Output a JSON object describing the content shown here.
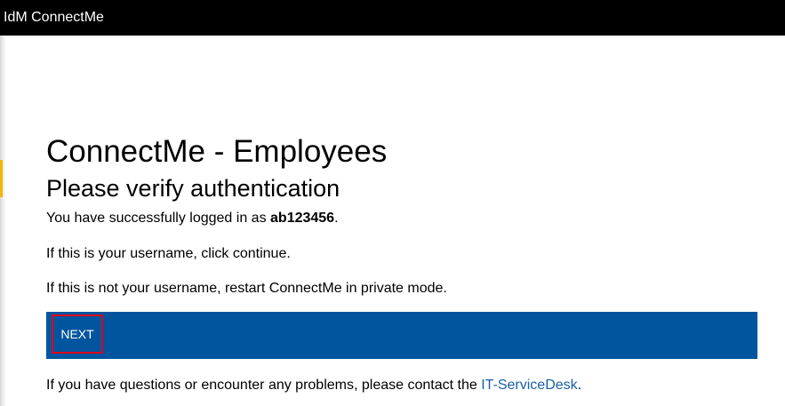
{
  "header": {
    "app_title": "IdM ConnectMe"
  },
  "main": {
    "title": "ConnectMe - Employees",
    "subtitle": "Please verify authentication",
    "logged_in_prefix": "You have successfully logged in as ",
    "username": "ab123456",
    "logged_in_suffix": ".",
    "continue_text": "If this is your username, click continue.",
    "private_mode_text": "If this is not your username, restart ConnectMe in private mode.",
    "next_label": "NEXT",
    "help_prefix": "If you have questions or encounter any problems, please contact the ",
    "help_link": "IT-ServiceDesk",
    "help_suffix": "."
  },
  "colors": {
    "topbar": "#000000",
    "action_bar": "#00559f",
    "highlight_border": "#e0001b",
    "link": "#1a5fa8",
    "accent": "#f4b400"
  }
}
